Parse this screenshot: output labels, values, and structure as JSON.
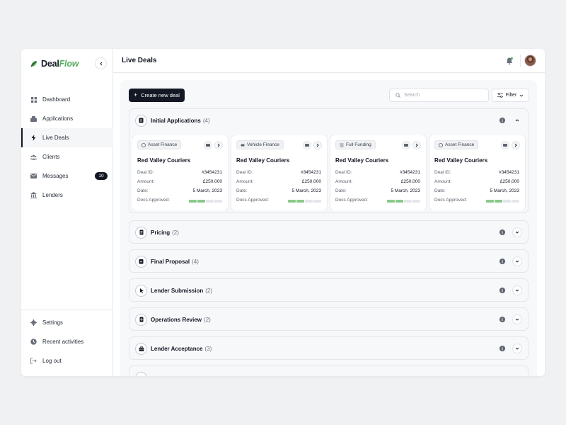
{
  "brand": {
    "name_part1": "Deal",
    "name_part2": "Flow"
  },
  "sidebar": {
    "items": [
      {
        "label": "Dashboard",
        "icon": "grid-icon"
      },
      {
        "label": "Applications",
        "icon": "inbox-icon"
      },
      {
        "label": "Live Deals",
        "icon": "lightning-icon"
      },
      {
        "label": "Clients",
        "icon": "users-icon"
      },
      {
        "label": "Messages",
        "icon": "mail-icon",
        "badge": "10"
      },
      {
        "label": "Lenders",
        "icon": "bank-icon"
      }
    ],
    "bottom_items": [
      {
        "label": "Settings",
        "icon": "gear-icon"
      },
      {
        "label": "Recent activities",
        "icon": "clock-icon"
      },
      {
        "label": "Log out",
        "icon": "logout-icon"
      }
    ]
  },
  "header": {
    "title": "Live Deals"
  },
  "toolbar": {
    "create_label": "Create new deal",
    "search_placeholder": "Search",
    "filter_label": "Filter"
  },
  "stages": [
    {
      "name": "Initial Applications",
      "count": "(4)",
      "expanded": true
    },
    {
      "name": "Pricing",
      "count": "(2)"
    },
    {
      "name": "Final Proposal",
      "count": "(4)"
    },
    {
      "name": "Lender Submission",
      "count": "(2)"
    },
    {
      "name": "Operations Review",
      "count": "(2)"
    },
    {
      "name": "Lender Acceptance",
      "count": "(3)"
    }
  ],
  "deal_labels": {
    "id": "Deal ID:",
    "amount": "Amount:",
    "date": "Date:",
    "docs": "Docs Approved:"
  },
  "deals": [
    {
      "tag": "Asset Finance",
      "title": "Red Valley Couriers",
      "id": "#3454231",
      "amount": "£250,000",
      "date": "5 March, 2023",
      "docs_approved": 2,
      "docs_total": 4
    },
    {
      "tag": "Vehicle Finance",
      "title": "Red Valley Couriers",
      "id": "#3454231",
      "amount": "£250,000",
      "date": "5 March, 2023",
      "docs_approved": 2,
      "docs_total": 4
    },
    {
      "tag": "Full Funding",
      "title": "Red Valley Couriers",
      "id": "#3454231",
      "amount": "£250,000",
      "date": "5 March, 2023",
      "docs_approved": 2,
      "docs_total": 4
    },
    {
      "tag": "Asset Finance",
      "title": "Red Valley Couriers",
      "id": "#3454231",
      "amount": "£250,000",
      "date": "5 March, 2023",
      "docs_approved": 2,
      "docs_total": 4
    }
  ],
  "colors": {
    "accent": "#141824",
    "brand_green": "#58b060",
    "progress_on": "#8bc98b",
    "progress_off": "#e4e6ea"
  }
}
